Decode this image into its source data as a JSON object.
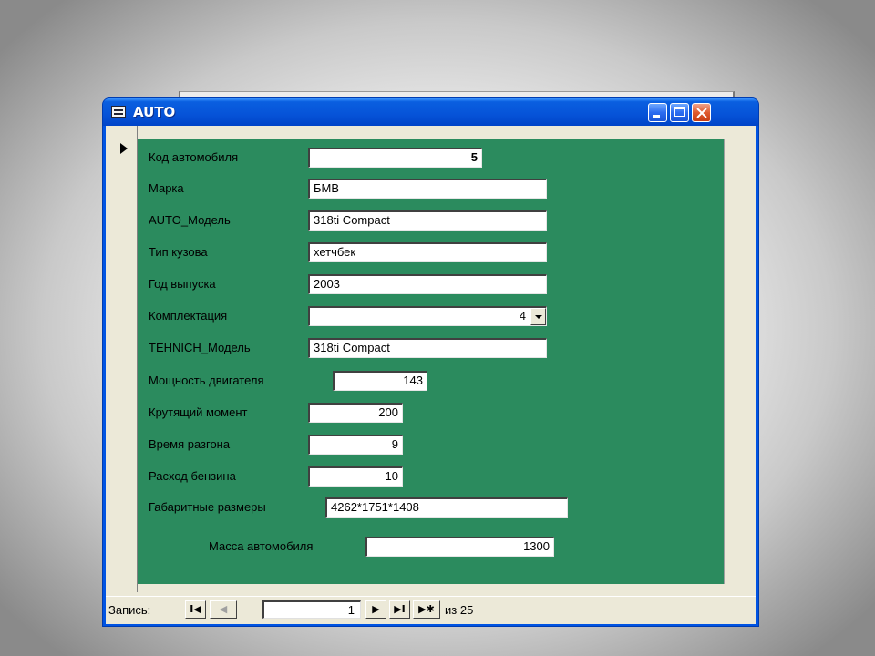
{
  "window": {
    "title": "AUTO"
  },
  "fields": [
    {
      "label": "Код автомобиля",
      "value": "5"
    },
    {
      "label": "Марка",
      "value": "БМВ"
    },
    {
      "label": "AUTO_Модель",
      "value": "318ti Compact"
    },
    {
      "label": "Тип кузова",
      "value": "хетчбек"
    },
    {
      "label": "Год выпуска",
      "value": "2003"
    },
    {
      "label": "Комплектация",
      "value": "4"
    },
    {
      "label": "TEHNICH_Модель",
      "value": "318ti Compact"
    },
    {
      "label": "Мощность двигателя",
      "value": "143"
    },
    {
      "label": "Крутящий момент",
      "value": "200"
    },
    {
      "label": "Время разгона",
      "value": "9"
    },
    {
      "label": "Расход бензина",
      "value": "10"
    },
    {
      "label": "Габаритные размеры",
      "value": "4262*1751*1408"
    },
    {
      "label": "Масса автомобиля",
      "value": "1300"
    }
  ],
  "nav": {
    "record_label": "Запись:",
    "first": "I◀",
    "prev": "◀",
    "current": "1",
    "next": "▶",
    "last": "▶I",
    "new": "▶✱",
    "of_text": "из 25"
  }
}
